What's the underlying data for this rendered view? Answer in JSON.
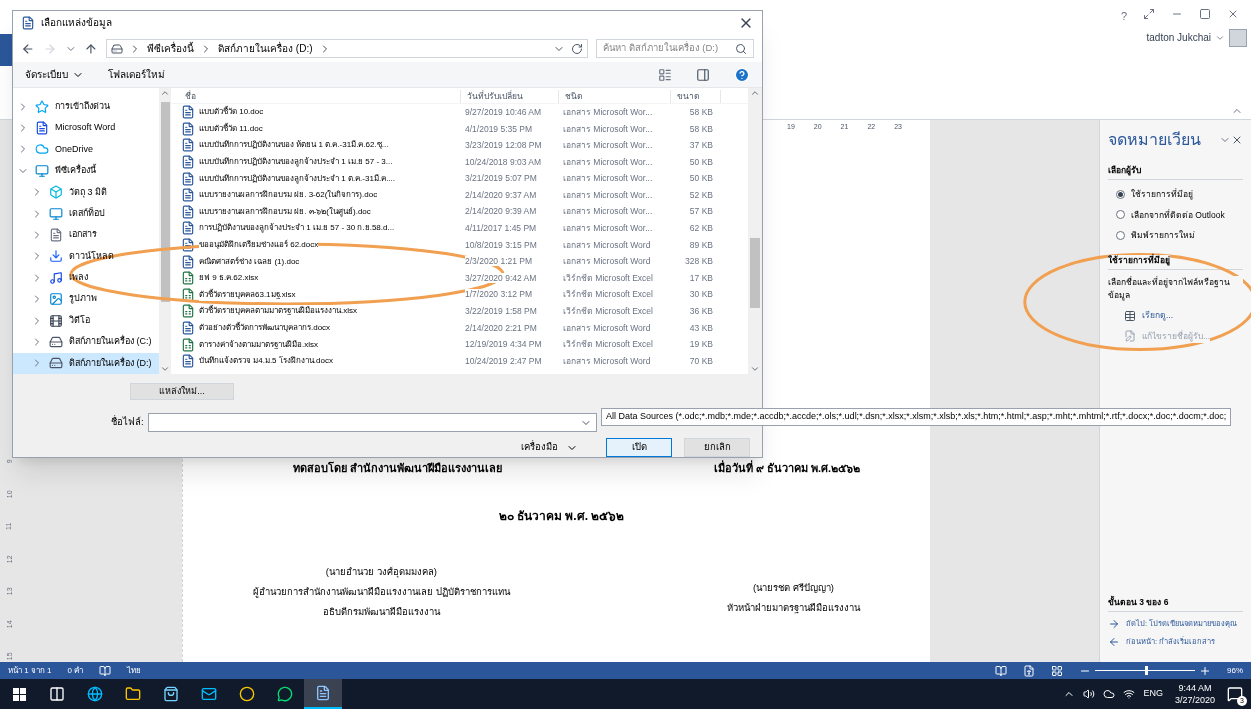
{
  "word_window": {
    "account": {
      "name": "tadton Jukchai"
    },
    "help": "?"
  },
  "dialog": {
    "title": "เลือกแหล่งข้อมูล",
    "address": {
      "crumbs": [
        "พีซีเครื่องนี้",
        "ดิสก์ภายในเครื่อง (D:)"
      ],
      "search_placeholder": "ค้นหา ดิสก์ภายในเครื่อง (D:)"
    },
    "toolbar": {
      "organize": "จัดระเบียบ",
      "new_folder": "โฟลเดอร์ใหม่"
    },
    "nav": [
      {
        "label": "การเข้าถึงด่วน",
        "kind": "star",
        "selected": false,
        "expanded": false
      },
      {
        "label": "Microsoft Word",
        "kind": "word",
        "selected": false,
        "expanded": false
      },
      {
        "label": "OneDrive",
        "kind": "cloud",
        "selected": false,
        "expanded": false
      },
      {
        "label": "พีซีเครื่องนี้",
        "kind": "pc",
        "selected": false,
        "expanded": true,
        "children": [
          {
            "label": "วัตถุ 3 มิติ",
            "kind": "cube",
            "selected": false,
            "expanded": false
          },
          {
            "label": "เดสก์ท็อป",
            "kind": "desktop",
            "selected": false,
            "expanded": false
          },
          {
            "label": "เอกสาร",
            "kind": "docs",
            "selected": false,
            "expanded": false
          },
          {
            "label": "ดาวน์โหลด",
            "kind": "download",
            "selected": false,
            "expanded": false
          },
          {
            "label": "เพลง",
            "kind": "music",
            "selected": false,
            "expanded": false
          },
          {
            "label": "รูปภาพ",
            "kind": "pictures",
            "selected": false,
            "expanded": false
          },
          {
            "label": "วิดีโอ",
            "kind": "video",
            "selected": false,
            "expanded": false
          },
          {
            "label": "ดิสก์ภายในเครื่อง (C:)",
            "kind": "drive",
            "selected": false,
            "expanded": false
          },
          {
            "label": "ดิสก์ภายในเครื่อง (D:)",
            "kind": "drive",
            "selected": true,
            "expanded": false
          }
        ]
      }
    ],
    "columns": [
      "ชื่อ",
      "วันที่ปรับเปลี่ยน",
      "ชนิด",
      "ขนาด"
    ],
    "files": [
      {
        "name": "แบบตัวชี้วัด 10.doc",
        "modified": "9/27/2019 10:46 AM",
        "type": "เอกสาร Microsoft Wor...",
        "size": "58 KB",
        "kind": "word"
      },
      {
        "name": "แบบตัวชี้วัด 11.doc",
        "modified": "4/1/2019 5:35 PM",
        "type": "เอกสาร Microsoft Wor...",
        "size": "58 KB",
        "kind": "word"
      },
      {
        "name": "แบบบันทึกการปฏิบัติงานของ ห้ตยน 1 ต.ค.-31มี.ค.62.ซุ...",
        "modified": "3/23/2019 12:08 PM",
        "type": "เอกสาร Microsoft Wor...",
        "size": "37 KB",
        "kind": "word"
      },
      {
        "name": "แบบบันทึกการปฏิบัติงานของลูกจ้างประจำ 1 เม.ย 57 - 3...",
        "modified": "10/24/2018 9:03 AM",
        "type": "เอกสาร Microsoft Wor...",
        "size": "50 KB",
        "kind": "word"
      },
      {
        "name": "แบบบันทึกการปฏิบัติงานของลูกจ้างประจำ 1 ต.ค.-31มี.ค....",
        "modified": "3/21/2019 5:07 PM",
        "type": "เอกสาร Microsoft Wor...",
        "size": "50 KB",
        "kind": "word"
      },
      {
        "name": "แบบรายงานผลการฝึกอบรม ฝย. 3-62(ในกิจการ).doc",
        "modified": "2/14/2020 9:37 AM",
        "type": "เอกสาร Microsoft Wor...",
        "size": "52 KB",
        "kind": "word"
      },
      {
        "name": "แบบรายงานผลการฝึกอบรม ฝย. ๓-๖๒(ในศูนย์).doc",
        "modified": "2/14/2020 9:39 AM",
        "type": "เอกสาร Microsoft Wor...",
        "size": "57 KB",
        "kind": "word"
      },
      {
        "name": "การปฏิบัติงานของลูกจ้างประจำ 1 เม.ย 57 - 30 ก.ย.58.d...",
        "modified": "4/11/2017 1:45 PM",
        "type": "เอกสาร Microsoft Wor...",
        "size": "62 KB",
        "kind": "word"
      },
      {
        "name": "ขออนุมัติฝึกเตรียมช่างแอร์ 62.docx",
        "modified": "10/8/2019 3:15 PM",
        "type": "เอกสาร Microsoft Word",
        "size": "89 KB",
        "kind": "word"
      },
      {
        "name": "คณิตศาสตร์ช่าง เฉลย (1).doc",
        "modified": "2/3/2020 1:21 PM",
        "type": "เอกสาร Microsoft Word",
        "size": "328 KB",
        "kind": "word"
      },
      {
        "name": "ยฟ 9 ธ.ค.62.xlsx",
        "modified": "3/27/2020 9:42 AM",
        "type": "เวิร์กชีต Microsoft Excel",
        "size": "17 KB",
        "kind": "excel"
      },
      {
        "name": "ตัวชี้วัดรายบุคคล63.1มฐ.xlsx",
        "modified": "1/7/2020 3:12 PM",
        "type": "เวิร์กชีต Microsoft Excel",
        "size": "30 KB",
        "kind": "excel"
      },
      {
        "name": "ตัวชี้วัดรายบุคคลตามมาตรฐานฝีมือแรงงาน.xlsx",
        "modified": "3/22/2019 1:58 PM",
        "type": "เวิร์กชีต Microsoft Excel",
        "size": "36 KB",
        "kind": "excel"
      },
      {
        "name": "ตัวอย่างตัวชี้วัดการพัฒนาบุคลากร.docx",
        "modified": "2/14/2020 2:21 PM",
        "type": "เอกสาร Microsoft Word",
        "size": "43 KB",
        "kind": "word"
      },
      {
        "name": "ตารางค่าจ้างตามมาตรฐานฝีมือ.xlsx",
        "modified": "12/19/2019 4:34 PM",
        "type": "เวิร์กชีต Microsoft Excel",
        "size": "19 KB",
        "kind": "excel"
      },
      {
        "name": "บันทึกแจ้งตรวจ ม4.ม.5 โรงฝึกงาน.docx",
        "modified": "10/24/2019 2:47 PM",
        "type": "เอกสาร Microsoft Word",
        "size": "70 KB",
        "kind": "word"
      }
    ],
    "new_source": "แหล่งใหม่...",
    "filename_label": "ชื่อไฟล์:",
    "filter": "All Data Sources (*.odc;*.mdb;*.mde;*.accdb;*.accde;*.ols;*.udl;*.dsn;*.xlsx;*.xlsm;*.xlsb;*.xls;*.htm;*.html;*.asp;*.mht;*.mhtml;*.rtf;*.docx;*.doc;*.docm;*.doc;",
    "tools": "เครื่องมือ",
    "open": "เปิด",
    "cancel": "ยกเลิก"
  },
  "ruler": [
    "19",
    "20",
    "21",
    "22",
    "23"
  ],
  "vertical_ruler": [
    "9",
    "10",
    "11",
    "12",
    "13",
    "14",
    "15"
  ],
  "document": {
    "lines": [
      {
        "left": "ทดสอบโดย   สำนักงานพัฒนาฝีมือแรงงานเลย",
        "right": "เมื่อวันที่   ๙  ธันวาคม พ.ศ.๒๕๖๒"
      }
    ],
    "date": "๒๐ ธันวาคม  พ.ศ.  ๒๕๖๒",
    "signers": [
      {
        "lines": [
          "(นายอำนวย วงศ์อุดมมงคล)",
          "ผู้อำนวยการสำนักงานพัฒนาฝีมือแรงงานเลย  ปฏิบัติราชการแทน",
          "อธิบดีกรมพัฒนาฝีมือแรงงาน"
        ]
      },
      {
        "lines": [
          "(นายรชต  ศรีปัญญา)",
          "หัวหน้าฝ่ายมาตรฐานฝีมือแรงงาน"
        ]
      }
    ]
  },
  "mail_merge_pane": {
    "title": "จดหมายเวียน",
    "section": "เลือกผู้รับ",
    "options": [
      {
        "label": "ใช้รายการที่มีอยู่",
        "selected": true
      },
      {
        "label": "เลือกจากที่ติดต่อ Outlook",
        "selected": false
      },
      {
        "label": "พิมพ์รายการใหม่",
        "selected": false
      }
    ],
    "section2": "ใช้รายการที่มีอยู่",
    "description": "เลือกชื่อและที่อยู่จากไฟล์หรือฐานข้อมูล",
    "links": [
      {
        "label": "เรียกดู...",
        "kind": "browse",
        "disabled": false
      },
      {
        "label": "แก้ไขรายชื่อผู้รับ...",
        "kind": "edit",
        "disabled": true
      }
    ],
    "step": "ขั้นตอน 3 ของ 6",
    "nav": [
      {
        "label": "ถัดไป: โปรดเขียนจดหมายของคุณ",
        "kind": "next"
      },
      {
        "label": "ก่อนหน้า: กำลังเริ่มเอกสาร",
        "kind": "back"
      }
    ]
  },
  "status_bar": {
    "page": "หน้า 1 จาก 1",
    "words": "0 คำ",
    "language": "ไทย",
    "zoom": {
      "level": 0.5,
      "reading": "96%"
    }
  },
  "taskbar": {
    "apps": [
      {
        "kind": "taskview",
        "active": false
      },
      {
        "kind": "edge",
        "active": false
      },
      {
        "kind": "explorer",
        "active": false
      },
      {
        "kind": "store",
        "active": false
      },
      {
        "kind": "mail",
        "active": false
      },
      {
        "kind": "chrome",
        "active": false
      },
      {
        "kind": "line",
        "active": false
      },
      {
        "kind": "word",
        "active": true
      }
    ],
    "language": "ENG",
    "time": "9:44 AM",
    "date": "3/27/2020",
    "notifications": "3"
  }
}
